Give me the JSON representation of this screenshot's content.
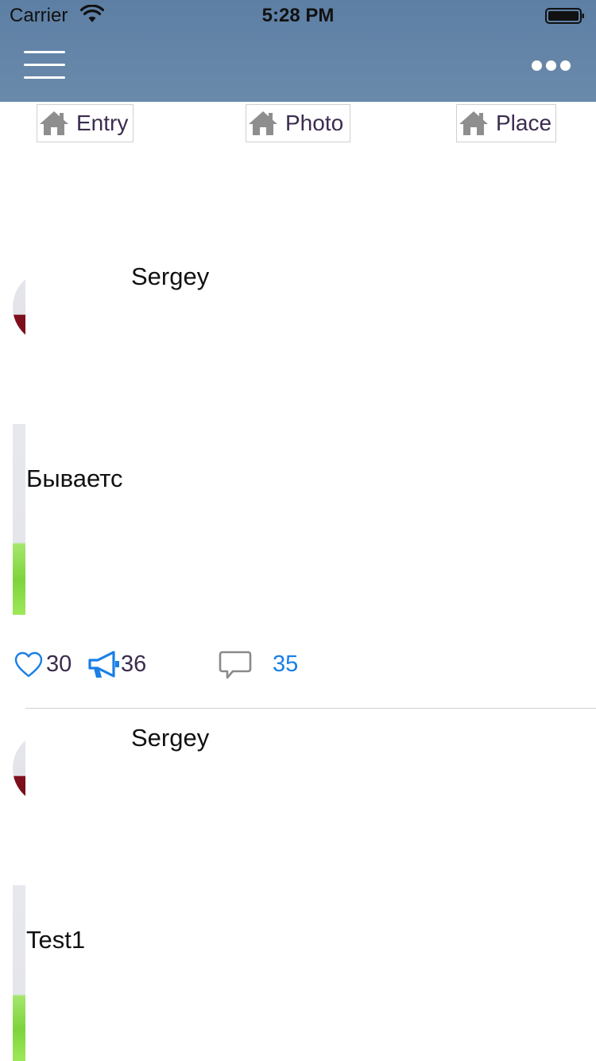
{
  "status_bar": {
    "carrier": "Carrier",
    "time": "5:28 PM",
    "wifi_icon": "wifi-icon",
    "battery_icon": "battery-icon"
  },
  "nav": {
    "menu_icon": "hamburger-menu-icon",
    "more_icon": "more-dots-icon",
    "bar_color": "#6586aa"
  },
  "tabs": [
    {
      "label": "Entry",
      "icon": "home-icon"
    },
    {
      "label": "Photo",
      "icon": "home-icon"
    },
    {
      "label": "Place",
      "icon": "home-icon"
    }
  ],
  "posts": [
    {
      "author": "Sergey",
      "text": "Бываетс",
      "likes": "30",
      "shares": "36",
      "comments": "35"
    },
    {
      "author": "Sergey",
      "text": "Test1"
    }
  ],
  "colors": {
    "accent_blue": "#1a7fe6",
    "count_text": "#3b2c4e"
  }
}
